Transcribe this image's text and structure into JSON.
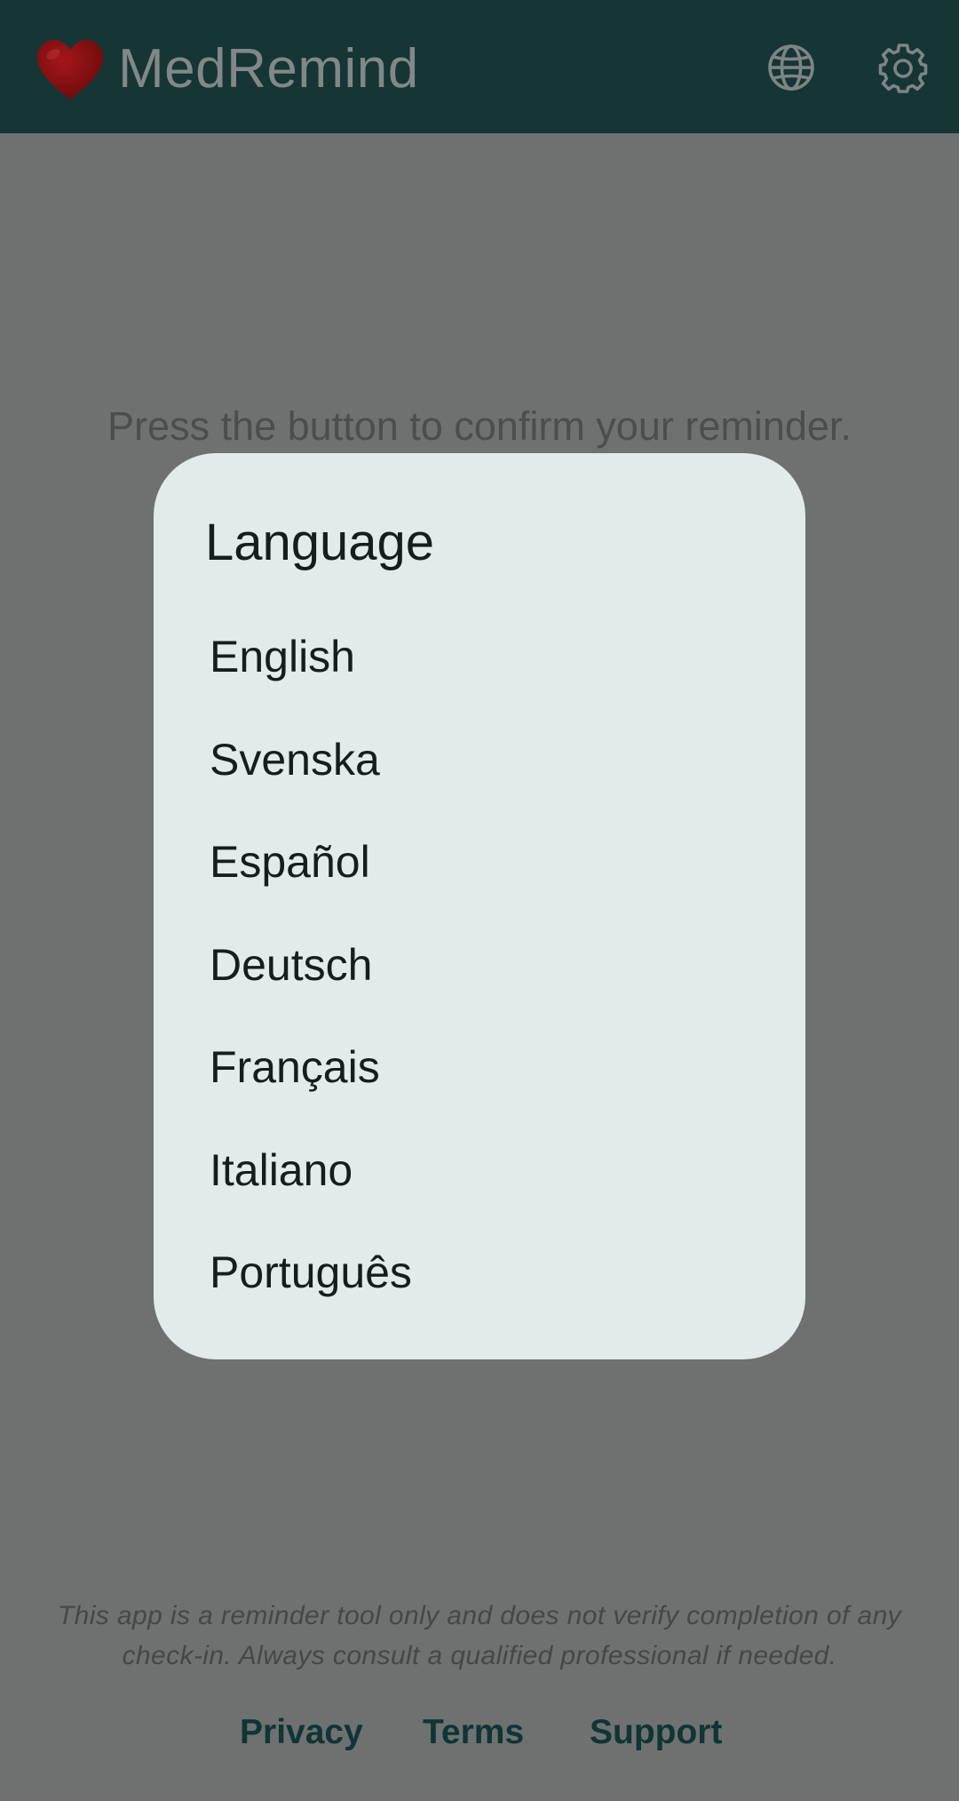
{
  "app_bar": {
    "logo_icon": "heart-icon",
    "title": "MedRemind",
    "actions": [
      {
        "icon": "globe-icon"
      },
      {
        "icon": "gear-icon"
      }
    ]
  },
  "main": {
    "prompt": "Press the button to confirm your reminder."
  },
  "language_dialog": {
    "title": "Language",
    "options": [
      "English",
      "Svenska",
      "Español",
      "Deutsch",
      "Français",
      "Italiano",
      "Português"
    ]
  },
  "footer": {
    "disclaimer": "This app is a reminder tool only and does not verify completion of any check-in. Always consult a qualified professional if needed.",
    "links": [
      "Privacy",
      "Terms",
      "Support"
    ]
  },
  "colors": {
    "app_bar_bg": "#163535",
    "scrim_bg": "#6f7170",
    "dialog_bg": "#e3eaea",
    "heart_red": "#8e0e10",
    "link_color": "#0f3535"
  }
}
